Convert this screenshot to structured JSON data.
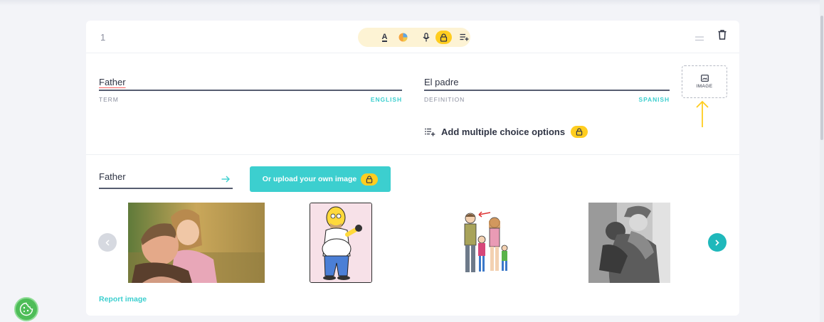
{
  "card": {
    "number": "1",
    "toolbar": {
      "icons": [
        "text-format-icon",
        "color-icon",
        "microphone-icon",
        "lock-icon",
        "add-list-icon"
      ],
      "text_format_glyph": "A",
      "colors": {
        "toolbar_bg": "#fdf3d4",
        "lock_pill": "#ffcd1f"
      }
    }
  },
  "term": {
    "value": "Father",
    "label": "TERM",
    "language": "ENGLISH"
  },
  "definition": {
    "value": "El padre",
    "label": "DEFINITION",
    "language": "SPANISH"
  },
  "image_button": {
    "label": "IMAGE"
  },
  "add_options": {
    "label": "Add multiple choice options"
  },
  "image_search": {
    "value": "Father",
    "upload_label": "Or upload your own image"
  },
  "carousel": {
    "images": [
      "father-daughter-photo",
      "homer-simpson-cartoon",
      "family-drawing",
      "father-child-bw-photo"
    ]
  },
  "report_link": "Report image",
  "colors": {
    "accent": "#3ccfcf",
    "accent_dark": "#1fb8bb",
    "lock": "#ffcd1f",
    "annotation_arrow": "#ffcd1f",
    "cookie": "#4ebd58"
  }
}
